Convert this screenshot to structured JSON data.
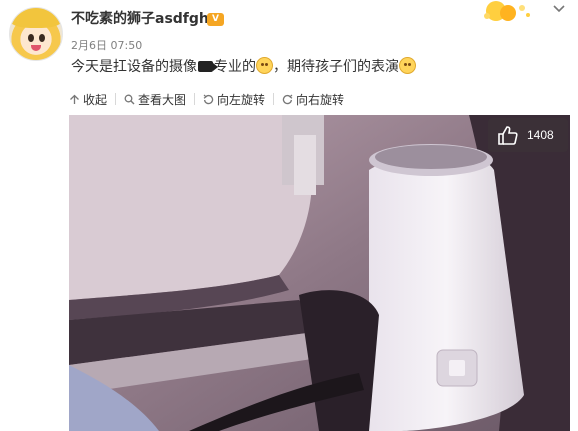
{
  "post": {
    "username": "不吃素的狮子asdfgh",
    "vip_badge_text": "Ⓥ",
    "timestamp": "2月6日 07:50",
    "text_before_camera": "今天是扛设备的摄像",
    "text_after_camera": "专业的",
    "text_middle": "，期待孩子们的表演"
  },
  "toolbar": {
    "collapse_label": "收起",
    "view_large_label": "查看大图",
    "rotate_left_label": "向左旋转",
    "rotate_right_label": "向右旋转"
  },
  "photo": {
    "like_count": "1408"
  },
  "colors": {
    "accent_orange": "#f5a623",
    "text_main": "#333333",
    "text_meta": "#808080"
  }
}
